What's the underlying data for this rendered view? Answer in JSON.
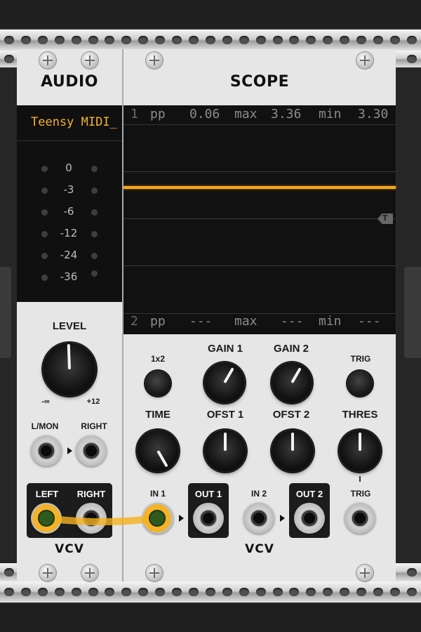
{
  "audio": {
    "title": "AUDIO",
    "device": "Teensy MIDI_",
    "vu_labels": [
      "0",
      "-3",
      "-6",
      "-12",
      "-24",
      "-36"
    ],
    "level_label": "LEVEL",
    "level_min": "-∞",
    "level_max": "+12",
    "lmon_label": "L/MON",
    "right_label": "RIGHT",
    "left_out_label": "LEFT",
    "right_out_label": "RIGHT",
    "logo": "VCV"
  },
  "scope": {
    "title": "SCOPE",
    "ch1": {
      "num": "1",
      "pp_label": "pp",
      "pp": "0.06",
      "max_label": "max",
      "max": "3.36",
      "min_label": "min",
      "min": "3.30"
    },
    "ch2": {
      "num": "2",
      "pp_label": "pp",
      "pp": "---",
      "max_label": "max",
      "max": "---",
      "min_label": "min",
      "min": "---"
    },
    "trigger_marker": "T",
    "mode_label": "1x2",
    "gain1_label": "GAIN 1",
    "gain2_label": "GAIN 2",
    "trig_label": "TRIG",
    "time_label": "TIME",
    "ofst1_label": "OFST 1",
    "ofst2_label": "OFST 2",
    "thres_label": "THRES",
    "in1_label": "IN 1",
    "out1_label": "OUT 1",
    "in2_label": "IN 2",
    "out2_label": "OUT 2",
    "trig_in_label": "TRIG",
    "logo": "VCV"
  },
  "colors": {
    "trace": "#f7a81b",
    "cable": "#f5b11f",
    "device_text": "#f7b22f",
    "panel": "#e6e6e6",
    "display_bg": "#111111"
  }
}
